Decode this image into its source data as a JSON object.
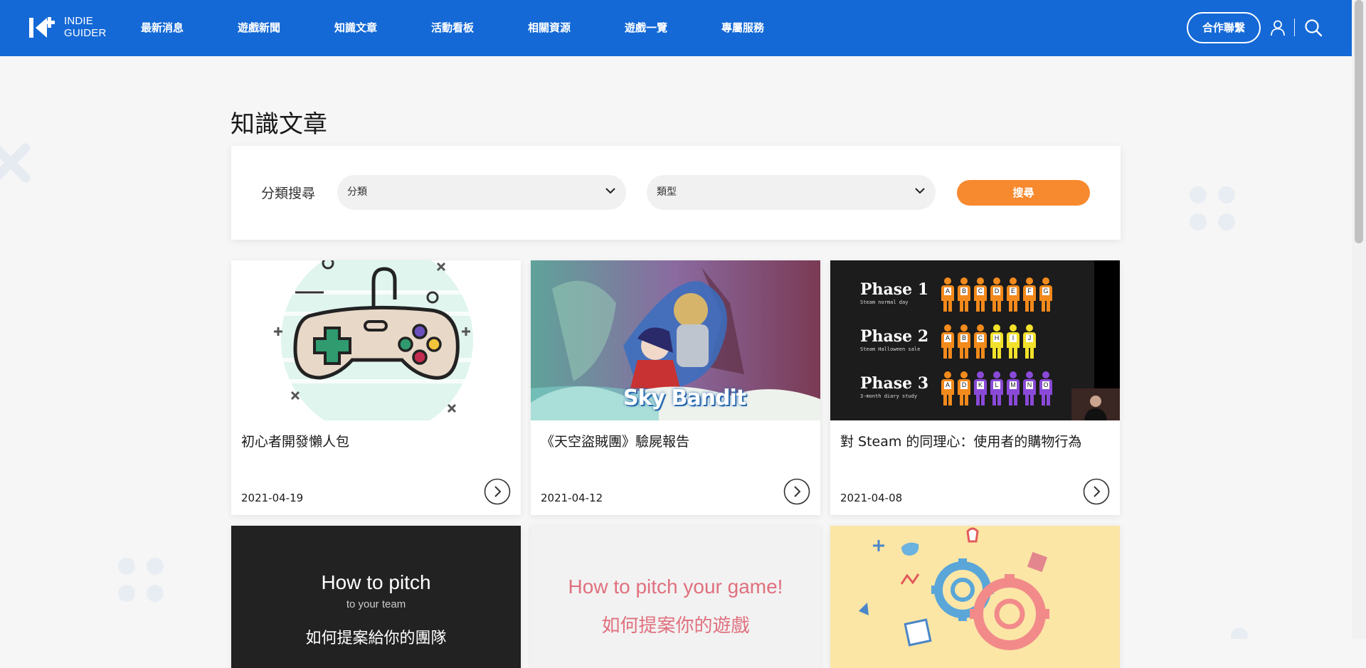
{
  "header": {
    "logo_line1": "INDIE",
    "logo_line2": "GUIDER",
    "nav": [
      "最新消息",
      "遊戲新聞",
      "知識文章",
      "活動看板",
      "相關資源",
      "遊戲一覽",
      "專屬服務"
    ],
    "partner_button": "合作聯繫",
    "icons": [
      "user-icon",
      "search-icon"
    ],
    "color": "#1469d6"
  },
  "page": {
    "title": "知識文章"
  },
  "filter": {
    "label": "分類搜尋",
    "category_select": "分類",
    "type_select": "類型",
    "search_button": "搜尋",
    "button_color": "#f7892e"
  },
  "articles": [
    {
      "title": "初心者開發懶人包",
      "date": "2021-04-19",
      "thumb": "gamepad-illustration"
    },
    {
      "title": "《天空盜賊團》驗屍報告",
      "date": "2021-04-12",
      "thumb": "sky-bandit-art",
      "thumb_text": "Sky Bandit"
    },
    {
      "title": "對 Steam 的同理心：使用者的購物行為",
      "date": "2021-04-08",
      "thumb": "phase-slide",
      "phases": [
        {
          "name": "Phase 1",
          "sub": "Steam normal day",
          "letters": [
            "A",
            "B",
            "C",
            "D",
            "E",
            "F",
            "G"
          ]
        },
        {
          "name": "Phase 2",
          "sub": "Steam Halloween sale",
          "letters": [
            "A",
            "B",
            "C",
            "H",
            "I",
            "J"
          ]
        },
        {
          "name": "Phase 3",
          "sub": "3-month diary study",
          "letters": [
            "A",
            "D",
            "K",
            "L",
            "M",
            "N",
            "O"
          ]
        }
      ]
    },
    {
      "title": "",
      "date": "",
      "thumb": "pitch-team-slide",
      "thumb_line1": "How to pitch",
      "thumb_line2": "to your team",
      "thumb_line3": "如何提案給你的團隊"
    },
    {
      "title": "",
      "date": "",
      "thumb": "pitch-game-slide",
      "thumb_line1": "How to pitch your game!",
      "thumb_line2": "如何提案你的遊戲"
    },
    {
      "title": "",
      "date": "",
      "thumb": "gears-illustration"
    }
  ]
}
